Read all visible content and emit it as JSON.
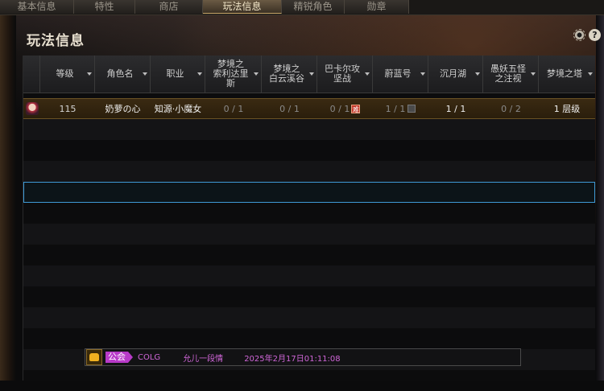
{
  "tabs": [
    {
      "label": "基本信息",
      "active": false
    },
    {
      "label": "特性",
      "active": false
    },
    {
      "label": "商店",
      "active": false
    },
    {
      "label": "玩法信息",
      "active": true
    },
    {
      "label": "精锐角色",
      "active": false
    },
    {
      "label": "勋章",
      "active": false
    }
  ],
  "panel": {
    "title": "玩法信息",
    "help_symbol": "?"
  },
  "table": {
    "headers": [
      "等级",
      "角色名",
      "职业",
      "梦境之\n索利达里\n斯",
      "梦境之\n白云溪谷",
      "巴卡尔攻\n坚战",
      "蔚蓝号",
      "沉月湖",
      "愚妖五怪\n之注视",
      "梦境之塔"
    ],
    "rows": [
      {
        "level": "115",
        "name": "奶萝の心",
        "job": "知源·小魔女",
        "c1": "0 / 1",
        "c2": "0 / 1",
        "c3": "0 / 1",
        "c3_badge": "难",
        "c4": "1 / 1",
        "c5": "1 / 1",
        "c6": "0 / 2",
        "c7": "1 层级"
      }
    ]
  },
  "chat": {
    "channel": "公会",
    "guild": "COLG",
    "sender": "允儿一段情",
    "time": "2025年2月17日01:11:08"
  },
  "colors": {
    "accent_selected": "#6a5224",
    "focus_row": "#3f9ad6",
    "chat_purple": "#b83ac8"
  }
}
